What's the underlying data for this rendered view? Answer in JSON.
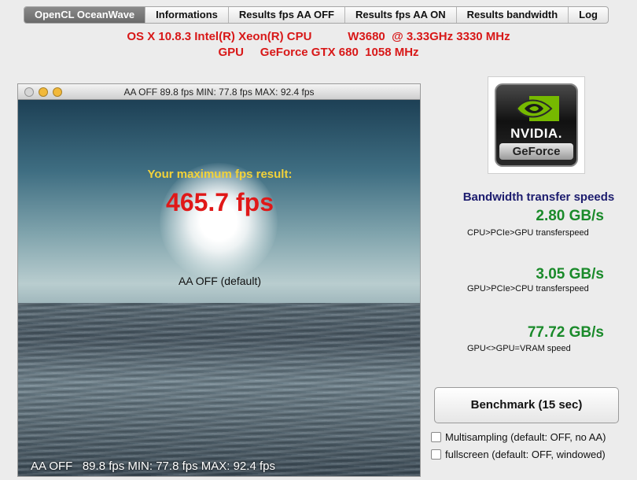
{
  "tabs": [
    {
      "label": "OpenCL OceanWave",
      "active": true
    },
    {
      "label": "Informations",
      "active": false
    },
    {
      "label": "Results fps AA OFF",
      "active": false
    },
    {
      "label": "Results fps AA ON",
      "active": false
    },
    {
      "label": "Results bandwidth",
      "active": false
    },
    {
      "label": "Log",
      "active": false
    }
  ],
  "system": {
    "cpu_line": "OS X 10.8.3 Intel(R) Xeon(R) CPU           W3680  @ 3.33GHz 3330 MHz",
    "gpu_line": "GPU     GeForce GTX 680  1058 MHz"
  },
  "render_window": {
    "title": "AA OFF   89.8 fps MIN: 77.8 fps MAX: 92.4 fps",
    "max_label": "Your maximum fps result:",
    "max_fps": "465.7 fps",
    "aa_mode": "AA OFF (default)",
    "overlay": "AA OFF   89.8 fps MIN: 77.8 fps MAX: 92.4 fps"
  },
  "logo": {
    "brand": "NVIDIA.",
    "product": "GeForce"
  },
  "bandwidth": {
    "title": "Bandwidth transfer speeds",
    "items": [
      {
        "value": "2.80 GB/s",
        "label": "CPU>PCIe>GPU transferspeed"
      },
      {
        "value": "3.05 GB/s",
        "label": "GPU>PCIe>CPU transferspeed"
      },
      {
        "value": "77.72 GB/s",
        "label": "GPU<>GPU=VRAM speed"
      }
    ]
  },
  "benchmark_button": "Benchmark  (15 sec)",
  "options": [
    {
      "label": "Multisampling (default: OFF, no AA)",
      "checked": false
    },
    {
      "label": "fullscreen (default: OFF, windowed)",
      "checked": false
    }
  ],
  "colors": {
    "system_text": "#d81818",
    "fps_big": "#e01818",
    "max_label": "#f2d23a",
    "speed_value": "#1a8a2a",
    "bandwidth_title": "#1c1c6e"
  }
}
